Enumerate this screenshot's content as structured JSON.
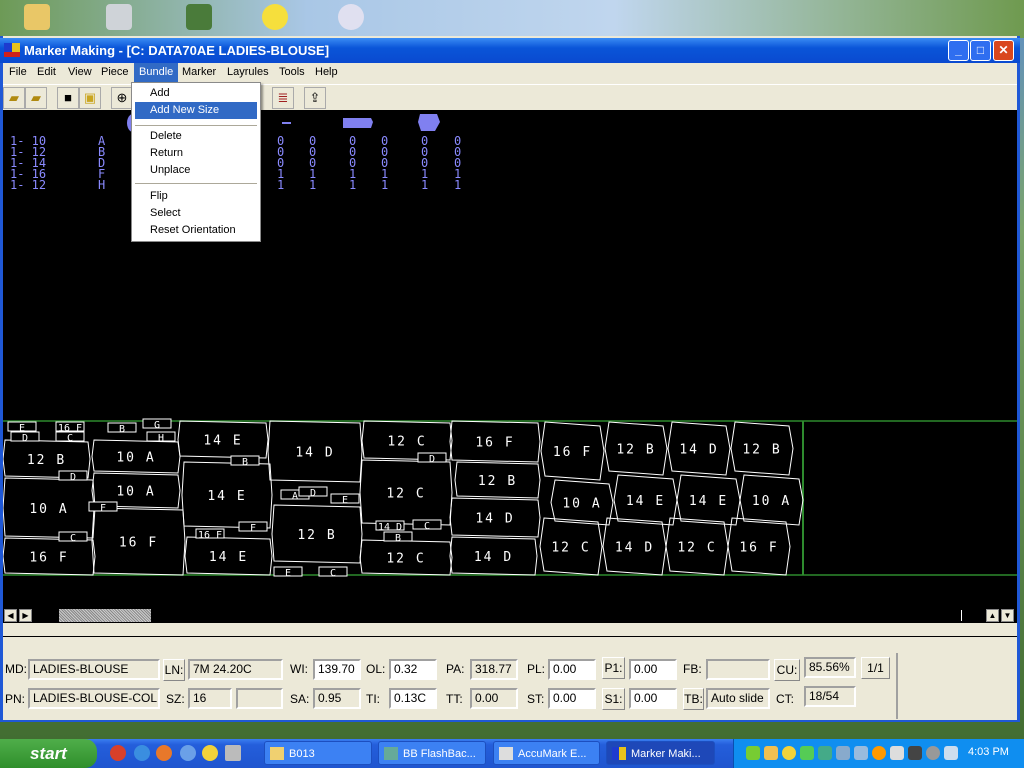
{
  "window": {
    "title": "Marker Making - [C:  DATA70AE  LADIES-BLOUSE]",
    "minimize": "_",
    "maximize": "□",
    "close": "✕"
  },
  "menu": [
    "File",
    "Edit",
    "View",
    "Piece",
    "Bundle",
    "Marker",
    "Layrules",
    "Tools",
    "Help"
  ],
  "active_menu": "Bundle",
  "bundle_menu": {
    "items": [
      "Add",
      "Add New Size",
      "Delete",
      "Return",
      "Unplace",
      "Flip",
      "Select",
      "Reset Orientation"
    ],
    "highlighted": "Add New Size"
  },
  "toolbar": [
    "open-icon",
    "open-arrow-icon",
    "save-icon",
    "save-as-icon",
    "zoom-in-icon",
    "notes-icon",
    "export-icon"
  ],
  "bundles": [
    {
      "qty": "1- 10",
      "sym": "A",
      "counts": [
        "0",
        "0",
        "0",
        "0",
        "0",
        "0"
      ]
    },
    {
      "qty": "1- 12",
      "sym": "B",
      "counts": [
        "0",
        "0",
        "0",
        "0",
        "0",
        "0"
      ]
    },
    {
      "qty": "1- 14",
      "sym": "D",
      "counts": [
        "0",
        "0",
        "0",
        "0",
        "0",
        "0"
      ]
    },
    {
      "qty": "1- 16",
      "sym": "F",
      "counts": [
        "1",
        "1",
        "1",
        "1",
        "1",
        "1"
      ]
    },
    {
      "qty": "1- 12",
      "sym": "H",
      "counts": [
        "1",
        "1",
        "1",
        "1",
        "1",
        "1"
      ]
    }
  ],
  "marker": {
    "pieces": [
      "12 B",
      "10 A",
      "16 F",
      "10 A",
      "10 A",
      "16 F",
      "14 E",
      "14 E",
      "14 E",
      "14 D",
      "12 B",
      "12 C",
      "12 C",
      "12 C",
      "16 F",
      "12 B",
      "14 D",
      "14 D",
      "16 F",
      "12 B",
      "14 D",
      "12 B",
      "10 A",
      "14 E",
      "14 E",
      "10 A",
      "12 C",
      "14 D",
      "12 C",
      "16 F"
    ],
    "small_pieces": [
      "E",
      "D",
      "16 F",
      "C",
      "B",
      "G",
      "H",
      "B",
      "D",
      "F",
      "C",
      "A",
      "D",
      "E",
      "F",
      "16 F",
      "14 D",
      "B",
      "C",
      "E",
      "C",
      "D"
    ],
    "colors": {
      "piece_outline": "#ffffff",
      "marker_border": "#2e8b2e",
      "bundle_text": "#8a8aff"
    }
  },
  "status": {
    "MD": "LADIES-BLOUSE",
    "LN": "7M 24.20C",
    "WI": "139.70",
    "OL": "0.32",
    "PA": "318.77",
    "PL": "0.00",
    "P1": "0.00",
    "FB": "",
    "CU": "85.56%",
    "page": "1/1",
    "PN": "LADIES-BLOUSE-COL",
    "SZ": "16",
    "SZ2": "",
    "SA": "0.95",
    "TI": "0.13C",
    "TT": "0.00",
    "ST": "0.00",
    "S1": "0.00",
    "TB": "Auto slide",
    "CT": "18/54",
    "labels": {
      "MD": "MD:",
      "LN": "LN:",
      "WI": "WI:",
      "OL": "OL:",
      "PA": "PA:",
      "PL": "PL:",
      "P1": "P1:",
      "FB": "FB:",
      "CU": "CU:",
      "PN": "PN:",
      "SZ": "SZ:",
      "SA": "SA:",
      "TI": "TI:",
      "TT": "TT:",
      "ST": "ST:",
      "S1": "S1:",
      "TB": "TB:",
      "CT": "CT:"
    }
  },
  "taskbar": {
    "start": "start",
    "tasks": [
      "B013",
      "BB FlashBac...",
      "AccuMark E...",
      "Marker Maki..."
    ],
    "active_task": "Marker Maki...",
    "clock": "4:03 PM"
  }
}
